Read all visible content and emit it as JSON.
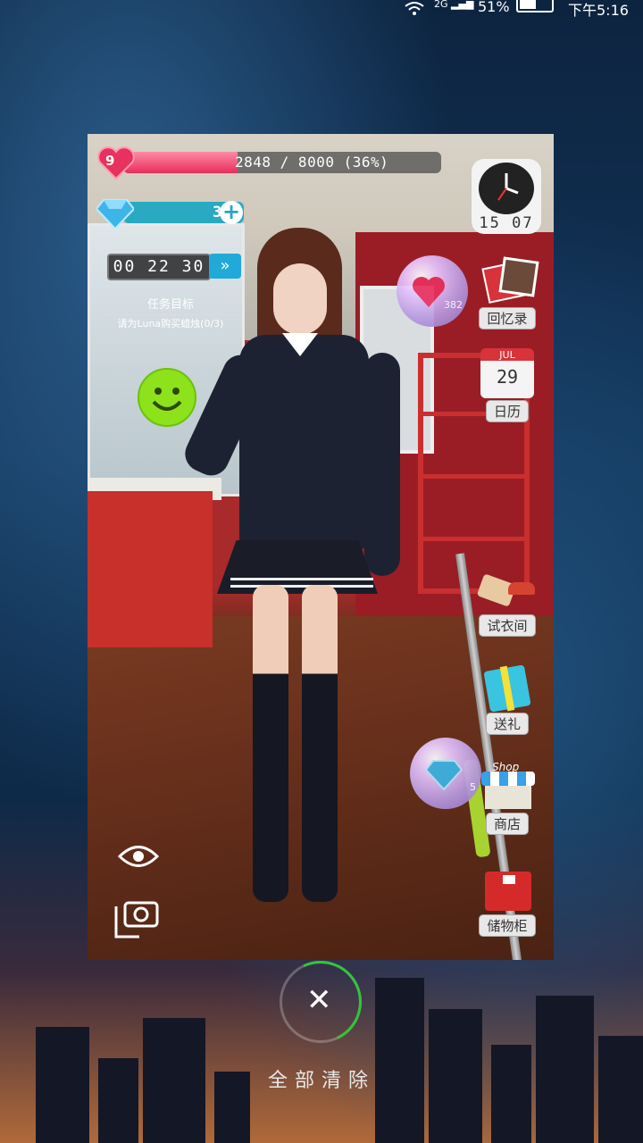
{
  "status_bar": {
    "signal_label": "2G",
    "battery_percent": "51%",
    "time": "下午5:16"
  },
  "game": {
    "level": "9",
    "affection_text": "2848 / 8000 (36%)",
    "affection_fraction": 0.36,
    "gems": "309",
    "timer": "00 22 30",
    "task_title": "任务目标",
    "task_text": "请为Luna购买蜡烛(0/3)",
    "clock_time": "15 07",
    "heart_bubble_count": "382",
    "gem_bubble_count": "5",
    "side_menu": {
      "memories": "回忆录",
      "calendar_month": "JUL",
      "calendar_day": "29",
      "calendar": "日历",
      "dressing_room": "试衣间",
      "gift": "送礼",
      "shop_sign": "Shop",
      "shop": "商店",
      "locker": "储物柜"
    }
  },
  "recents": {
    "clear_all": "全部清除"
  },
  "colors": {
    "xp_fill": "#e62d5a",
    "gem_bar": "#2aa9c2",
    "smiley": "#8ee21b",
    "clear_ring_progress": "#35c33a"
  }
}
